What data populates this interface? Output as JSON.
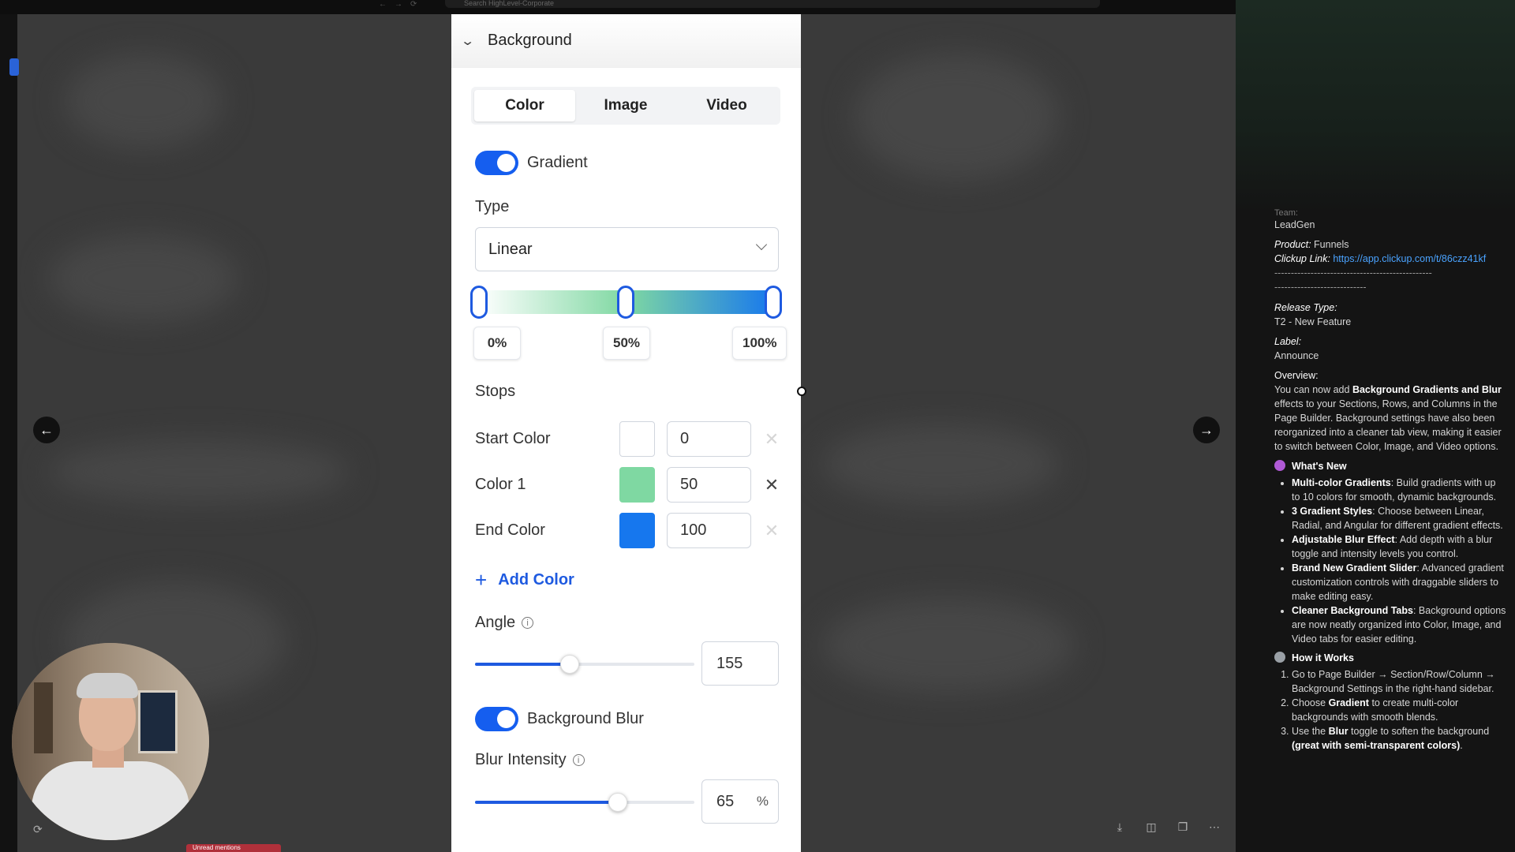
{
  "search": {
    "placeholder": "Search HighLevel-Corporate"
  },
  "panel": {
    "header_title": "Background",
    "tabs": [
      {
        "label": "Color",
        "active": true
      },
      {
        "label": "Image",
        "active": false
      },
      {
        "label": "Video",
        "active": false
      }
    ],
    "gradient": {
      "label": "Gradient",
      "enabled": true
    },
    "type": {
      "label": "Type",
      "value": "Linear"
    },
    "gradient_bar": {
      "stops_pct": [
        "0%",
        "50%",
        "100%"
      ],
      "colors": [
        "#ffffff",
        "#7fd8a2",
        "#1677ee"
      ]
    },
    "stops": {
      "label": "Stops",
      "rows": [
        {
          "name": "Start Color",
          "value": "0",
          "color": "#ffffff"
        },
        {
          "name": "Color 1",
          "value": "50",
          "color": "#7fd8a2"
        },
        {
          "name": "End Color",
          "value": "100",
          "color": "#1677ee"
        }
      ],
      "add_label": "Add Color"
    },
    "angle": {
      "label": "Angle",
      "value": "155",
      "max": 360
    },
    "blur": {
      "label": "Background Blur",
      "enabled": true
    },
    "blur_intensity": {
      "label": "Blur Intensity",
      "value": "65",
      "unit": "%",
      "max": 100
    }
  },
  "notes": {
    "team_label": "Team:",
    "team_value": "LeadGen",
    "product_label": "Product:",
    "product_value": "Funnels",
    "clickup_label": "Clickup Link:",
    "clickup_value": "https://app.clickup.com/t/86czz41kf",
    "dash1": "------------------------------------------------",
    "dash2": "----------------------------",
    "release_label": "Release Type:",
    "release_value": "T2 - New Feature",
    "label_label": "Label:",
    "label_value": "Announce",
    "overview_label": "Overview:",
    "overview_pre": "You can now add ",
    "overview_bold": "Background Gradients and Blur",
    "overview_post": " effects to your Sections, Rows, and Columns in the Page Builder. Background settings have also been reorganized into a cleaner tab view, making it easier to switch between Color, Image, and Video options.",
    "whats_new_title": "What's New",
    "whats_new": [
      {
        "b": "Multi-color Gradients",
        "t": ": Build gradients with up to 10 colors for smooth, dynamic backgrounds."
      },
      {
        "b": "3 Gradient Styles",
        "t": ": Choose between Linear, Radial, and Angular for different gradient effects."
      },
      {
        "b": "Adjustable Blur Effect",
        "t": ": Add depth with a blur toggle and intensity levels you control."
      },
      {
        "b": "Brand New Gradient Slider",
        "t": ": Advanced gradient customization controls with draggable sliders to make editing easy."
      },
      {
        "b": "Cleaner Background Tabs",
        "t": ": Background options are now neatly organized into Color, Image, and Video tabs for easier editing."
      }
    ],
    "how_title": "How it Works",
    "how_1": "Go to Page Builder → Section/Row/Column → Background Settings in the right-hand sidebar.",
    "how_2_pre": "Choose ",
    "how_2_bold": "Gradient",
    "how_2_post": " to create multi-color backgrounds with smooth blends.",
    "how_3_pre": "Use the ",
    "how_3_bold": "Blur",
    "how_3_mid": " toggle to soften the background ",
    "how_3_bold2": "(great with semi-transparent colors)",
    "how_3_post": "."
  },
  "bottom_tag": "Unread mentions",
  "icons": {
    "prev": "arrow-left-icon",
    "next": "arrow-right-icon",
    "collapse": "chevron-down-icon",
    "dropdown": "chevron-down-icon",
    "remove": "close-icon",
    "add": "plus-icon",
    "info": "info-icon",
    "refresh": "refresh-icon"
  },
  "colors": {
    "accent": "#155eef",
    "link": "#4aa3ff"
  }
}
